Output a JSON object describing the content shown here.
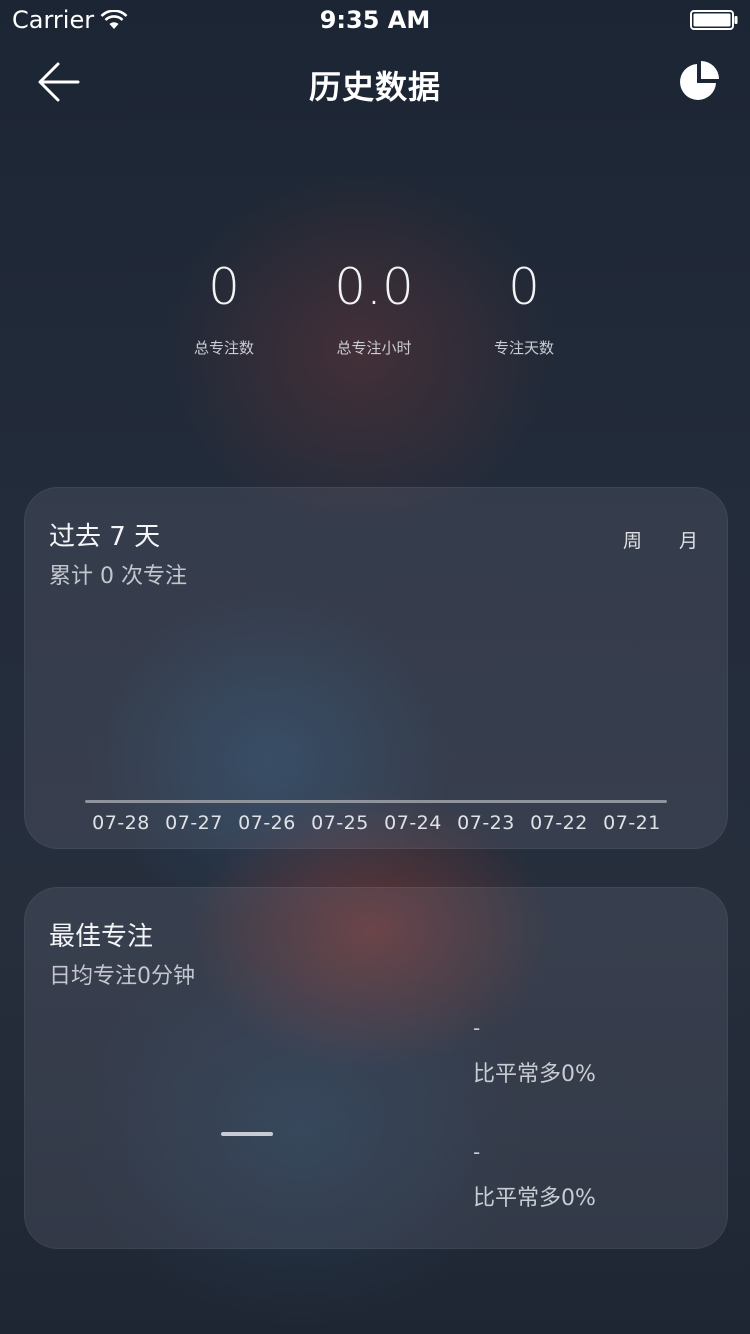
{
  "status_bar": {
    "carrier": "Carrier",
    "time": "9:35 AM"
  },
  "nav": {
    "title": "历史数据",
    "back_icon": "arrow-left-icon",
    "chart_icon": "pie-chart-icon"
  },
  "summary": [
    {
      "value": "0",
      "label": "总专注数"
    },
    {
      "value": "0.0",
      "label": "总专注小时"
    },
    {
      "value": "0",
      "label": "专注天数"
    }
  ],
  "weekly": {
    "title": "过去 7 天",
    "subtitle": "累计 0 次专注",
    "segments": {
      "week": "周",
      "month": "月"
    }
  },
  "chart_data": {
    "type": "bar",
    "categories": [
      "07-28",
      "07-27",
      "07-26",
      "07-25",
      "07-24",
      "07-23",
      "07-22",
      "07-21"
    ],
    "values": [
      0,
      0,
      0,
      0,
      0,
      0,
      0,
      0
    ]
  },
  "best": {
    "title": "最佳专注",
    "subtitle": "日均专注0分钟",
    "item1_value": "-",
    "item1_text": "比平常多0%",
    "item2_value": "-",
    "item2_text": "比平常多0%"
  },
  "colors": {
    "accent_warm": "#963c32",
    "text_muted": "#c2c6cd"
  }
}
